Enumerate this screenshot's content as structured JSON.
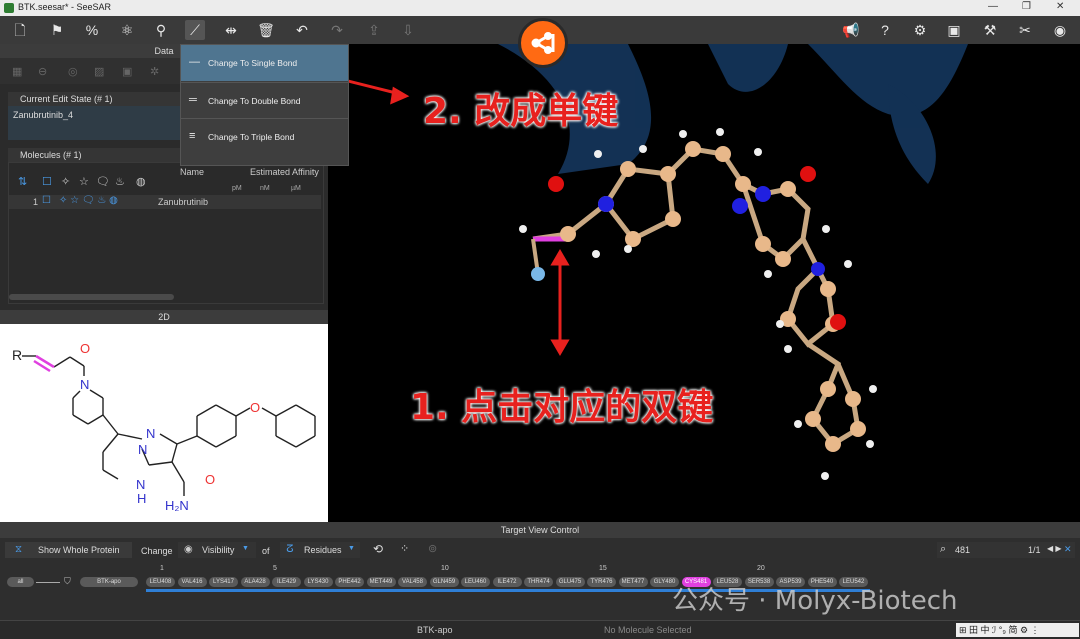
{
  "window": {
    "title": "BTK.seesar* - SeeSAR"
  },
  "menu": {
    "items": [
      {
        "label": "Change To Single Bond"
      },
      {
        "label": "Change To Double Bond"
      },
      {
        "label": "Change To Triple Bond"
      }
    ]
  },
  "left_panel": {
    "data_header": "Data",
    "edit_state_title": "Current Edit State (# 1)",
    "edit_state_value": "Zanubrutinib_4",
    "molecules_title": "Molecules (# 1)",
    "table_headers": {
      "name": "Name",
      "affinity": "Estimated Affinity"
    },
    "units": [
      "pM",
      "nM",
      "µM"
    ],
    "row_number": "1",
    "row_name": "Zanubrutinib",
    "panel_2d_title": "2D",
    "structure_labels": {
      "r": "R",
      "o1": "O",
      "n1": "N",
      "n2": "N",
      "n3": "N",
      "nh": "N",
      "h": "H",
      "o2": "O",
      "o3": "O",
      "nh2": "H₂N"
    }
  },
  "annotations": {
    "step2": "2. 改成单键",
    "step1": "1. 点击对应的双键"
  },
  "target_view": {
    "title": "Target View Control",
    "show_whole_protein": "Show Whole Protein",
    "change": "Change",
    "visibility": "Visibility",
    "of": "of",
    "residues": "Residues",
    "search_value": "481",
    "search_count": "1/1",
    "ruler": [
      "1",
      "5",
      "10",
      "15",
      "20"
    ],
    "all": "all",
    "chain": "BTK-apo",
    "residues_list": [
      "LEU408",
      "VAL416",
      "LYS417",
      "ALA428",
      "ILE429",
      "LYS430",
      "PHE442",
      "MET449",
      "VAL458",
      "GLN459",
      "LEU460",
      "ILE472",
      "THR474",
      "GLU475",
      "TYR476",
      "MET477",
      "GLY480",
      "CYS481",
      "LEU528",
      "SER538",
      "ASP539",
      "PHE540",
      "LEU542"
    ]
  },
  "status": {
    "left": "BTK-apo",
    "right": "No Molecule Selected"
  },
  "watermark": "公众号 · Molyx-Biotech",
  "colors": {
    "accent_orange": "#ff6a13",
    "annotation_red": "#e8211e",
    "highlight_bond": "#e040e0",
    "menu_highlight": "#4f7590"
  }
}
